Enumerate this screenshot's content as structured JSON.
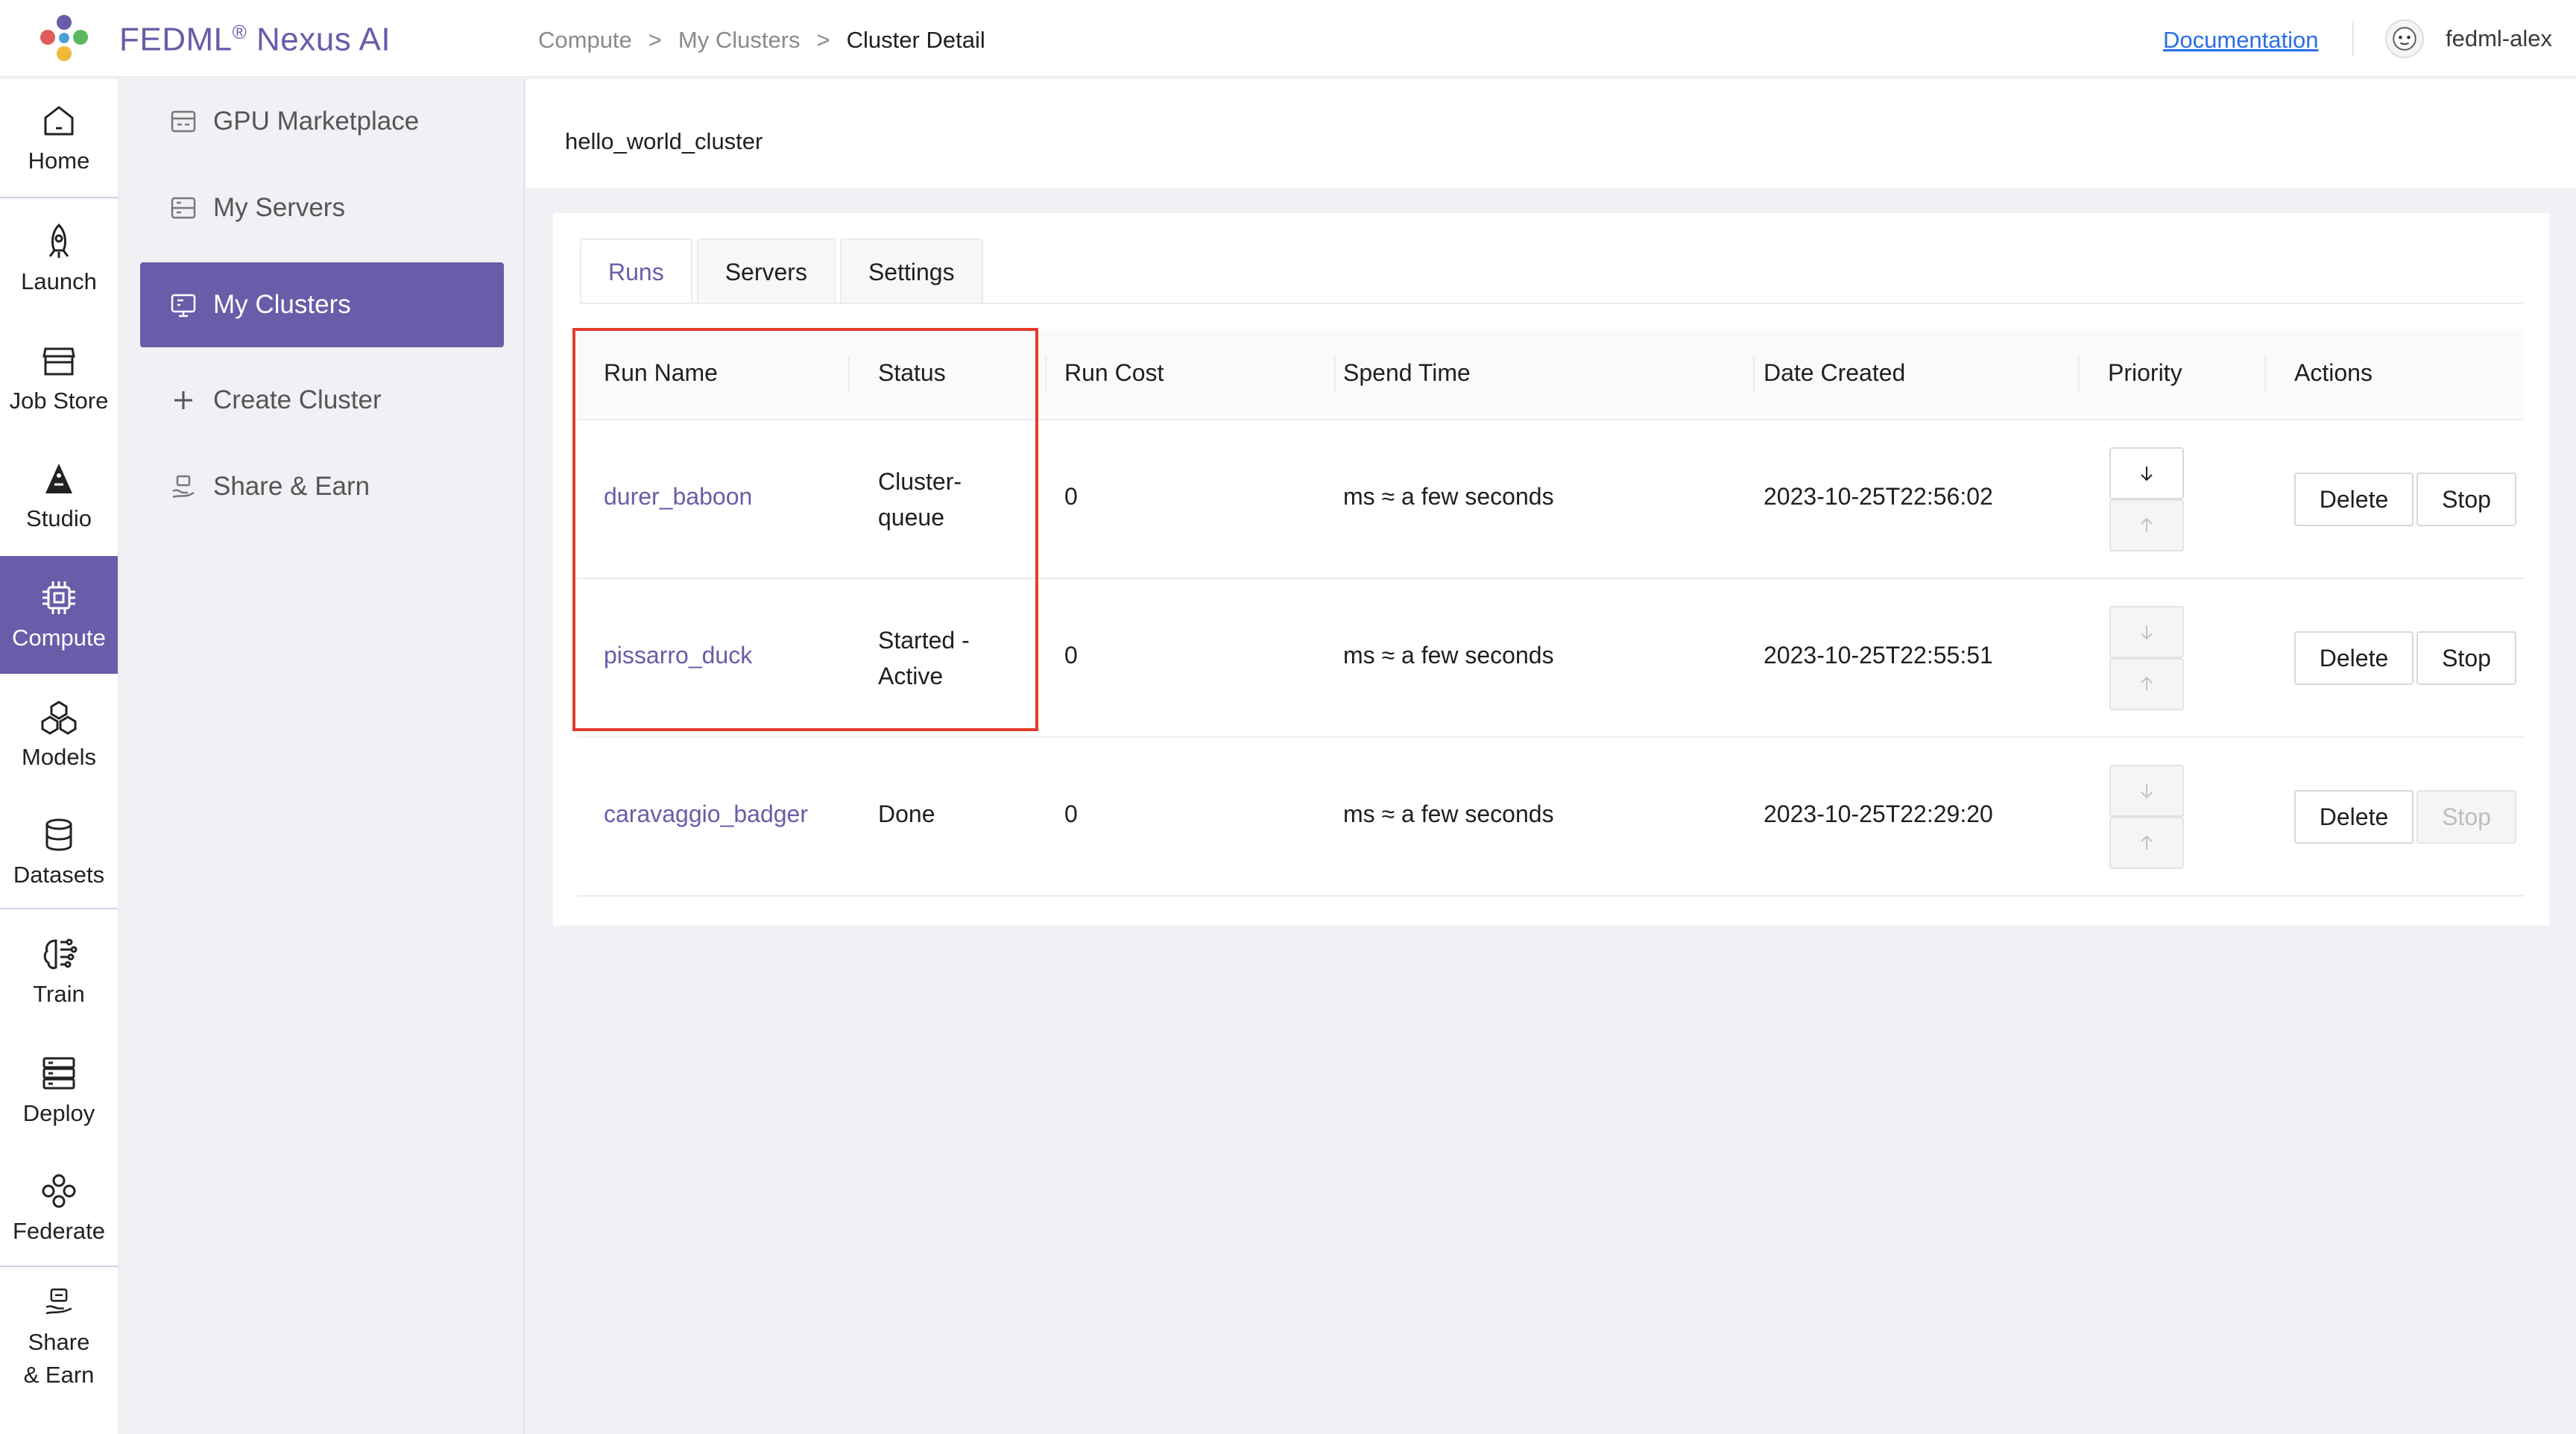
{
  "header": {
    "brand": "FEDML",
    "brand_reg": "®",
    "brand_suffix": " Nexus AI",
    "breadcrumb": [
      "Compute",
      "My Clusters",
      "Cluster Detail"
    ],
    "breadcrumb_sep": ">",
    "documentation_link": "Documentation",
    "username": "fedml-alex"
  },
  "rail": {
    "items": [
      {
        "label": "Home",
        "icon": "home-icon"
      },
      {
        "label": "Launch",
        "icon": "rocket-icon"
      },
      {
        "label": "Job Store",
        "icon": "store-icon"
      },
      {
        "label": "Studio",
        "icon": "studio-icon"
      },
      {
        "label": "Compute",
        "icon": "chip-icon",
        "active": true
      },
      {
        "label": "Models",
        "icon": "cubes-icon"
      },
      {
        "label": "Datasets",
        "icon": "database-icon"
      },
      {
        "label": "Train",
        "icon": "brain-icon"
      },
      {
        "label": "Deploy",
        "icon": "server-icon"
      },
      {
        "label": "Federate",
        "icon": "federate-icon"
      },
      {
        "label": "Share",
        "label2": "& Earn",
        "icon": "share-earn-icon"
      }
    ]
  },
  "subnav": {
    "items": [
      {
        "label": "GPU Marketplace",
        "icon": "marketplace-icon"
      },
      {
        "label": "My Servers",
        "icon": "servers-icon"
      },
      {
        "label": "My Clusters",
        "icon": "clusters-icon",
        "active": true
      },
      {
        "label": "Create Cluster",
        "icon": "plus-icon"
      },
      {
        "label": "Share & Earn",
        "icon": "share-earn-icon"
      }
    ]
  },
  "main": {
    "cluster_name": "hello_world_cluster",
    "tabs": [
      {
        "label": "Runs",
        "active": true
      },
      {
        "label": "Servers"
      },
      {
        "label": "Settings"
      }
    ],
    "table": {
      "columns": [
        "Run Name",
        "Status",
        "Run Cost",
        "Spend Time",
        "Date Created",
        "Priority",
        "Actions"
      ],
      "rows": [
        {
          "run_name": "durer_baboon",
          "status_1": "Cluster-",
          "status_2": "queue",
          "cost": "0",
          "spend_time": "ms ≈ a few seconds",
          "date_created": "2023-10-25T22:56:02",
          "delete": "Delete",
          "stop": "Stop",
          "stop_disabled": false,
          "prio_down_disabled": false,
          "prio_up_disabled": true
        },
        {
          "run_name": "pissarro_duck",
          "status_1": "Started -",
          "status_2": "Active",
          "cost": "0",
          "spend_time": "ms ≈ a few seconds",
          "date_created": "2023-10-25T22:55:51",
          "delete": "Delete",
          "stop": "Stop",
          "stop_disabled": false,
          "prio_down_disabled": true,
          "prio_up_disabled": true
        },
        {
          "run_name": "caravaggio_badger",
          "status_1": "Done",
          "status_2": "",
          "cost": "0",
          "spend_time": "ms ≈ a few seconds",
          "date_created": "2023-10-25T22:29:20",
          "delete": "Delete",
          "stop": "Stop",
          "stop_disabled": true,
          "prio_down_disabled": true,
          "prio_up_disabled": true
        }
      ]
    }
  },
  "colors": {
    "accent": "#6a5ca8",
    "link": "#2a6ee8",
    "highlight": "#e53b2c"
  }
}
